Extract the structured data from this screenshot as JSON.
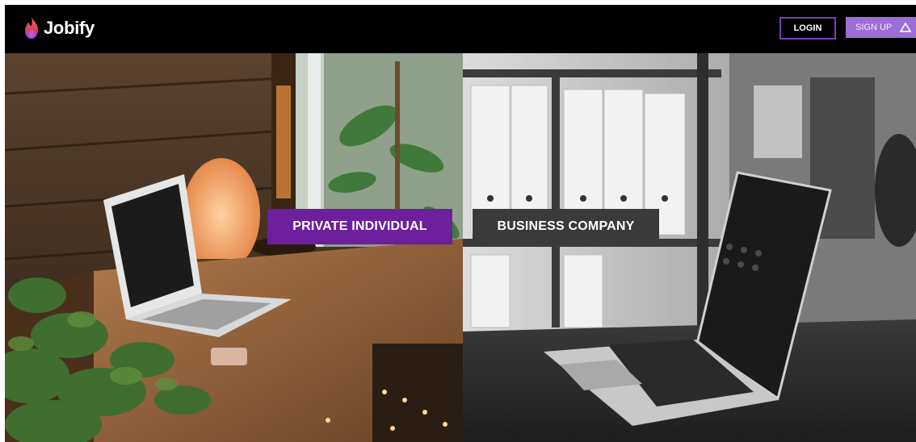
{
  "header": {
    "brand": "Jobify",
    "login_label": "LOGIN",
    "signup_label": "SIGN UP"
  },
  "hero": {
    "private_label": "PRIVATE INDIVIDUAL",
    "business_label": "BUSINESS COMPANY"
  },
  "icons": {
    "logo": "flame-icon",
    "signup": "triangle-icon"
  },
  "colors": {
    "brand_purple": "#6d1f9c",
    "signup_purple": "#9c6fd8",
    "business_gray": "#3a3a3a"
  }
}
